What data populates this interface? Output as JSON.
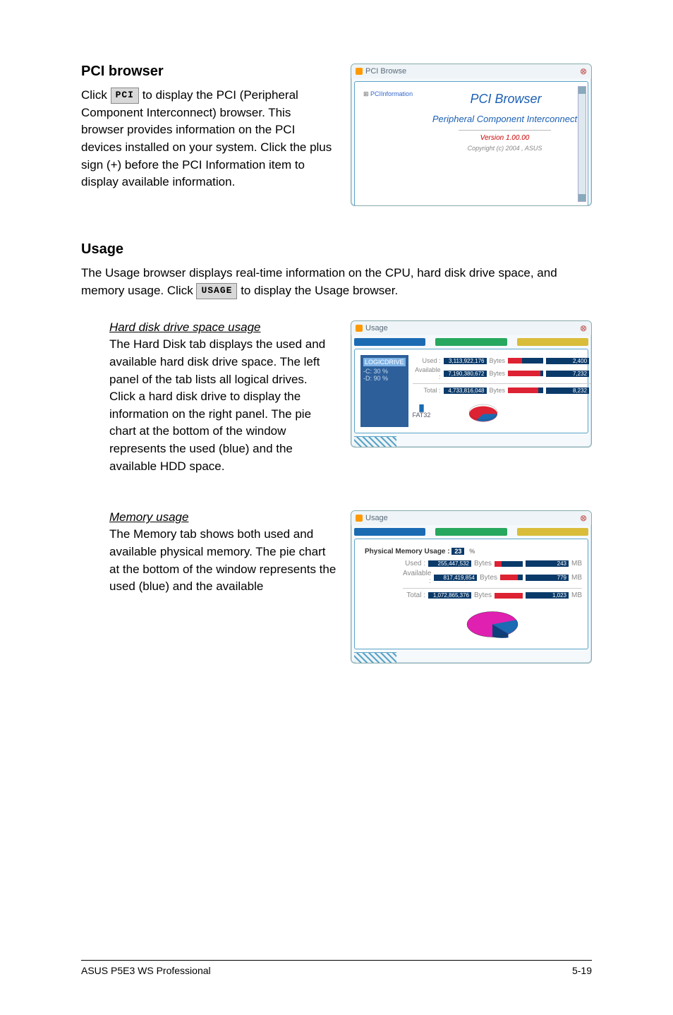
{
  "section_pci": {
    "title": "PCI browser",
    "prefix": "Click ",
    "button": "PCI",
    "suffix": " to display the PCI (Peripheral Component Interconnect) browser. This browser provides information on the PCI devices installed on your system. Click the plus sign (+) before the PCI Information item to display available information."
  },
  "win_pci": {
    "titlebar": "PCI Browse",
    "tree_root": "PCIInformation",
    "heading": "PCI Browser",
    "sub": "Peripheral Component Interconnect",
    "version": "Version 1.00.00",
    "copyright": "Copyright (c) 2004 , ASUS"
  },
  "section_usage": {
    "title": "Usage",
    "prefix": "The Usage browser displays real-time information on the CPU, hard disk drive space, and memory usage. Click ",
    "button": "USAGE",
    "suffix": " to display the Usage browser."
  },
  "hdd": {
    "heading": "Hard disk drive space usage",
    "text": "The Hard Disk tab displays the used and available hard disk drive space. The left panel of the tab lists all logical drives. Click a hard disk drive to display the information on the right panel. The pie chart at the bottom of the window represents the used (blue) and the available HDD space."
  },
  "win_hdd": {
    "titlebar": "Usage",
    "drive_header": "LOGICDRIVE",
    "drives": [
      "-C: 30 %",
      "-D: 90 %"
    ],
    "rows": [
      {
        "label": "Used :",
        "val": "3,113,922,176",
        "unit": "Bytes",
        "mb": "2,400",
        "munit": "MB",
        "pct": 40
      },
      {
        "label": "Available :",
        "val": "7,190,380,672",
        "unit": "Bytes",
        "mb": "7,232",
        "munit": "MB",
        "pct": 92
      }
    ],
    "total": {
      "label": "Total :",
      "val": "4,733,816,048",
      "unit": "Bytes",
      "mb": "8,232",
      "munit": "MB",
      "pct": 85
    },
    "pie_label": "FAT32"
  },
  "mem": {
    "heading": "Memory usage",
    "text": "The Memory tab shows both used and available physical memory. The pie chart at the bottom of the window represents the used (blue) and the available"
  },
  "win_mem": {
    "titlebar": "Usage",
    "header_prefix": "Physical Memory Usage :",
    "header_val": "23",
    "header_unit": "%",
    "rows": [
      {
        "label": "Used :",
        "val": "255,447,532",
        "unit": "Bytes",
        "mb": "243",
        "munit": "MB",
        "pct": 25
      },
      {
        "label": "Available :",
        "val": "817,419,854",
        "unit": "Bytes",
        "mb": "779",
        "munit": "MB",
        "pct": 78
      }
    ],
    "total": {
      "label": "Total :",
      "val": "1,072,865,376",
      "unit": "Bytes",
      "mb": "1,023",
      "munit": "MB",
      "pct": 100
    }
  },
  "footer": {
    "left": "ASUS P5E3 WS Professional",
    "right": "5-19"
  }
}
